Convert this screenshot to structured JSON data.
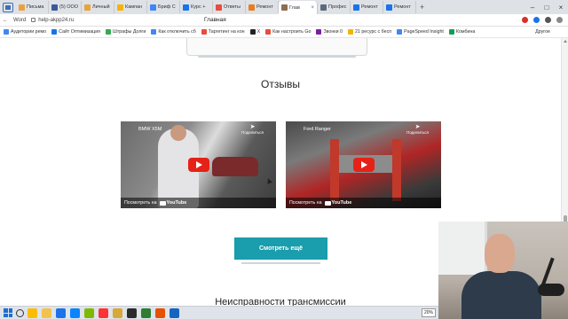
{
  "browser": {
    "tabs": [
      {
        "label": "Письма",
        "color": "#e8a33d",
        "active": false
      },
      {
        "label": "(5) ООО",
        "color": "#3b5998",
        "active": false
      },
      {
        "label": "Личный",
        "color": "#e8a33d",
        "active": false
      },
      {
        "label": "Кампан",
        "color": "#f4b400",
        "active": false
      },
      {
        "label": "Бриф С",
        "color": "#4285f4",
        "active": false
      },
      {
        "label": "Курс +",
        "color": "#1a73e8",
        "active": false
      },
      {
        "label": "Ответы",
        "color": "#e74c3c",
        "active": false
      },
      {
        "label": "Ремонт",
        "color": "#e67e22",
        "active": false
      },
      {
        "label": "Глав",
        "color": "#8e6e53",
        "active": true
      },
      {
        "label": "Профес",
        "color": "#5a6b7b",
        "active": false
      },
      {
        "label": "Ремонт",
        "color": "#1a73e8",
        "active": false
      },
      {
        "label": "Ремонт",
        "color": "#1a73e8",
        "active": false
      }
    ],
    "back_label": "←",
    "word_label": "Word",
    "url": "help-akpp24.ru",
    "page_title": "Главная",
    "bookmarks": [
      {
        "label": "Аудитории ремо",
        "color": "#4285f4"
      },
      {
        "label": "Сайт Оптимизация",
        "color": "#1a73e8"
      },
      {
        "label": "Штрафы Долги",
        "color": "#34a853"
      },
      {
        "label": "Как отключить сб",
        "color": "#4285f4"
      },
      {
        "label": "Таргетинг на кон",
        "color": "#e74c3c"
      },
      {
        "label": "X",
        "color": "#222222"
      },
      {
        "label": "Как настроить Go",
        "color": "#e74c3c"
      },
      {
        "label": "Звонки 0",
        "color": "#7b1fa2"
      },
      {
        "label": "21 ресурс с бесп",
        "color": "#f4b400"
      },
      {
        "label": "PageSpeed Insight",
        "color": "#4285f4"
      },
      {
        "label": "Комбина",
        "color": "#0f9d58"
      }
    ],
    "bookmarks_other": "Другое"
  },
  "page": {
    "reviews_heading": "Отзывы",
    "videos": [
      {
        "title": "BMW X5M",
        "share_label": "Поделиться",
        "watch_label": "Посмотреть на",
        "yt_label": "YouTube"
      },
      {
        "title": "Ford Ranger",
        "share_label": "Поделиться",
        "watch_label": "Посмотреть на",
        "yt_label": "YouTube"
      }
    ],
    "more_button": "Смотреть ещё",
    "section2_heading": "Неисправности трансмиссии"
  },
  "taskbar": {
    "apps": [
      {
        "name": "chrome-icon",
        "color": "#fbbc05"
      },
      {
        "name": "explorer-icon",
        "color": "#f2c14e"
      },
      {
        "name": "app-l-icon",
        "color": "#1a73e8"
      },
      {
        "name": "edge-icon",
        "color": "#0a84ff"
      },
      {
        "name": "photos-icon",
        "color": "#7fb800"
      },
      {
        "name": "yandex-icon",
        "color": "#ff3333"
      },
      {
        "name": "folder-icon",
        "color": "#d8a838"
      },
      {
        "name": "terminal-icon",
        "color": "#2b2b2b"
      },
      {
        "name": "camtasia-icon",
        "color": "#2e7d32"
      },
      {
        "name": "app-c-icon",
        "color": "#e65100"
      },
      {
        "name": "app-l2-icon",
        "color": "#1565c0"
      }
    ],
    "tray_badge": "20%"
  },
  "colors": {
    "accent": "#1a9dac",
    "youtube": "#e62117"
  }
}
